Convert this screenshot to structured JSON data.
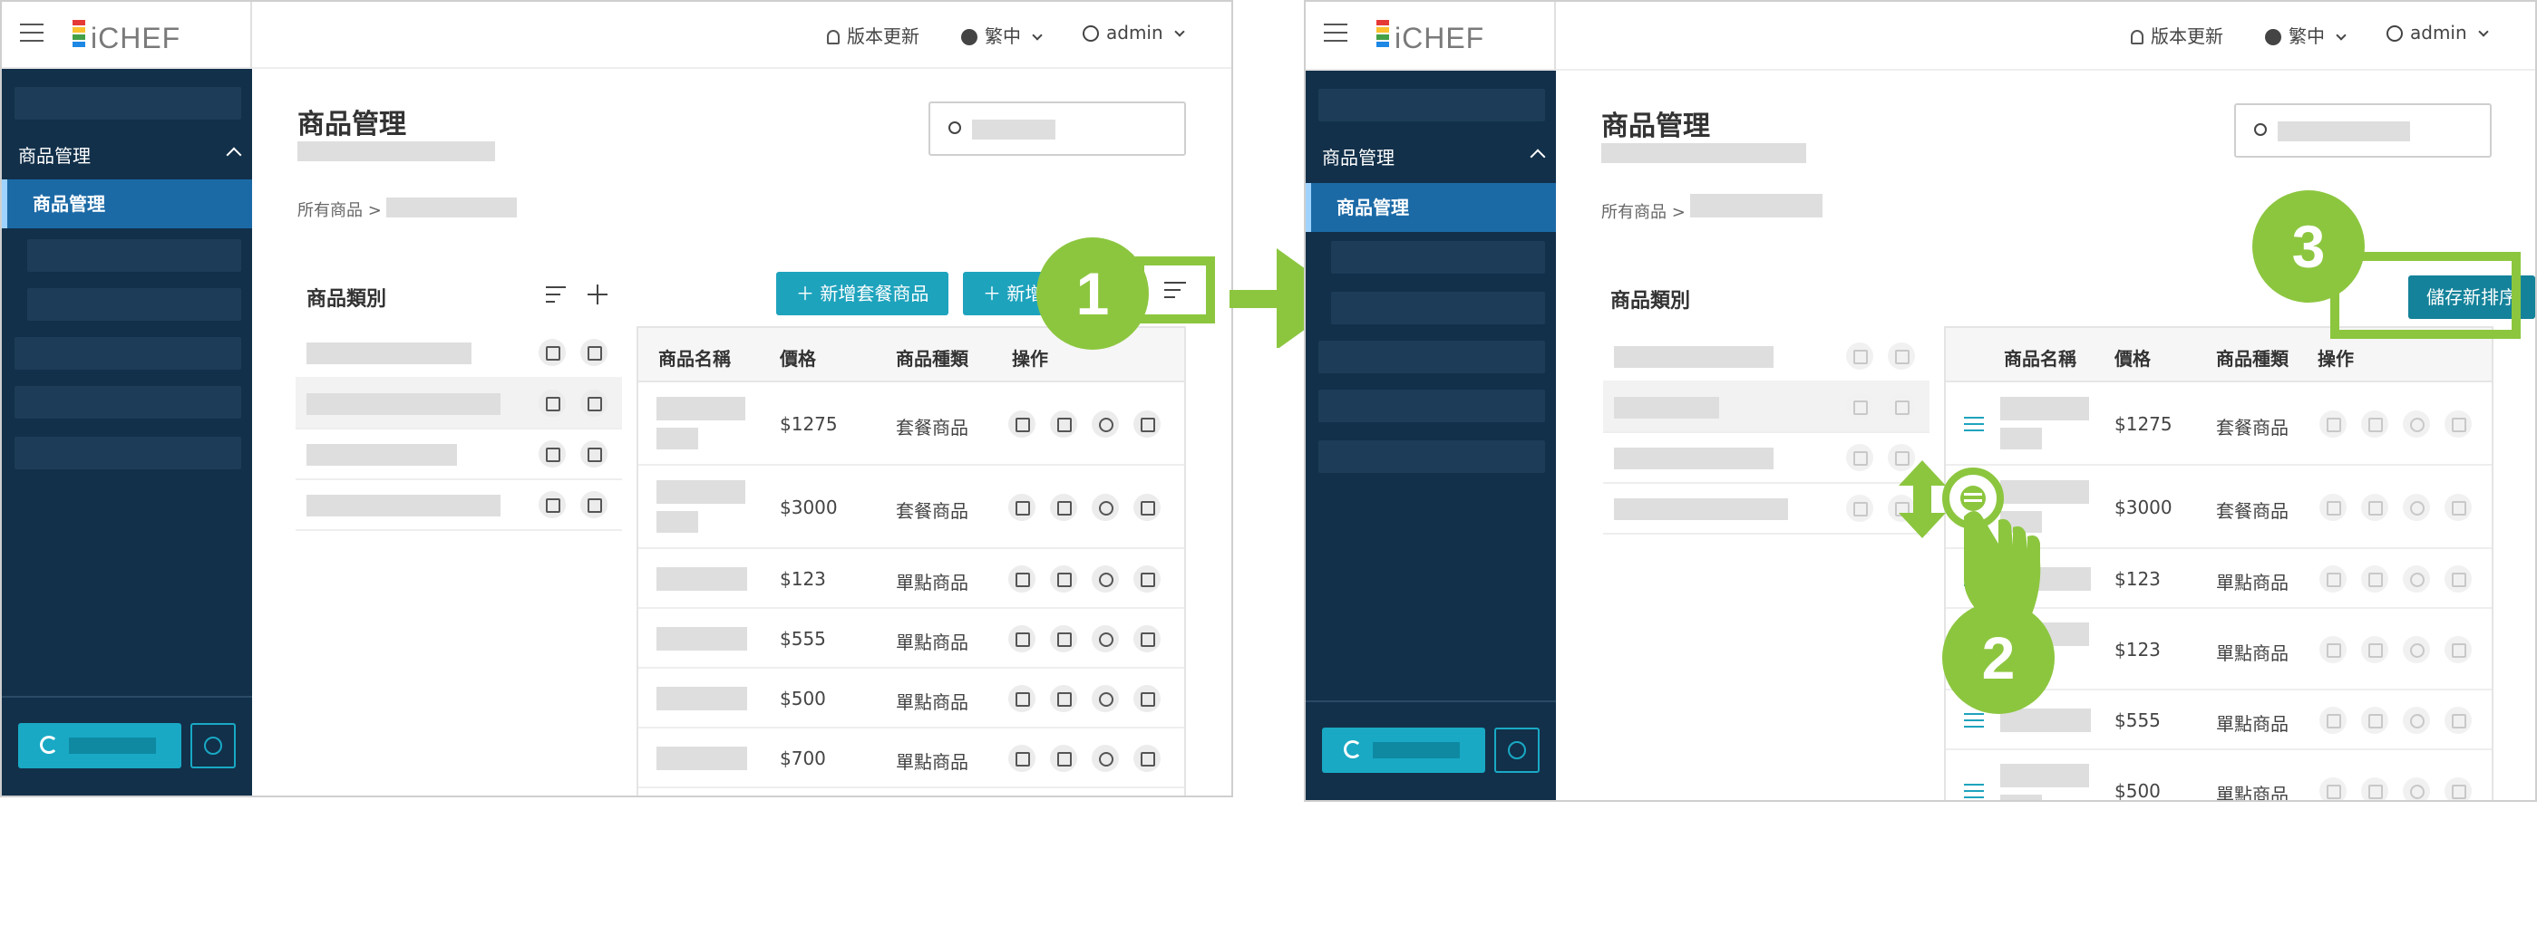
{
  "brand": {
    "logo_text": "iCHEF",
    "logo_colors": [
      "#e53935",
      "#fbc02d",
      "#43a047",
      "#1e88e5"
    ]
  },
  "topbar": {
    "update": "版本更新",
    "lang": "繁中",
    "user": "admin"
  },
  "sidebar": {
    "section": "商品管理",
    "active_item": "商品管理"
  },
  "page": {
    "title": "商品管理",
    "breadcrumb_root": "所有商品",
    "breadcrumb_sep": ">"
  },
  "categories": {
    "title": "商品類別"
  },
  "actions": {
    "add_combo": "新增套餐商品",
    "add_item_partial": "新增",
    "save_order": "儲存新排序"
  },
  "table": {
    "headers": [
      "商品名稱",
      "價格",
      "商品種類",
      "操作"
    ],
    "rows_left": [
      {
        "price": "$1275",
        "type": "套餐商品"
      },
      {
        "price": "$3000",
        "type": "套餐商品"
      },
      {
        "price": "$123",
        "type": "單點商品"
      },
      {
        "price": "$555",
        "type": "單點商品"
      },
      {
        "price": "$500",
        "type": "單點商品"
      },
      {
        "price": "$700",
        "type": "單點商品"
      }
    ],
    "rows_right": [
      {
        "price": "$1275",
        "type": "套餐商品"
      },
      {
        "price": "$3000",
        "type": "套餐商品"
      },
      {
        "price": "$123",
        "type": "單點商品"
      },
      {
        "price": "$123",
        "type": "單點商品"
      },
      {
        "price": "$555",
        "type": "單點商品"
      },
      {
        "price": "$500",
        "type": "單點商品"
      }
    ]
  },
  "steps": [
    "1",
    "2",
    "3"
  ],
  "colors": {
    "accent": "#8cc63f",
    "teal": "#1ea3bd",
    "sidebar": "#12304a",
    "active": "#1b6aa6"
  }
}
